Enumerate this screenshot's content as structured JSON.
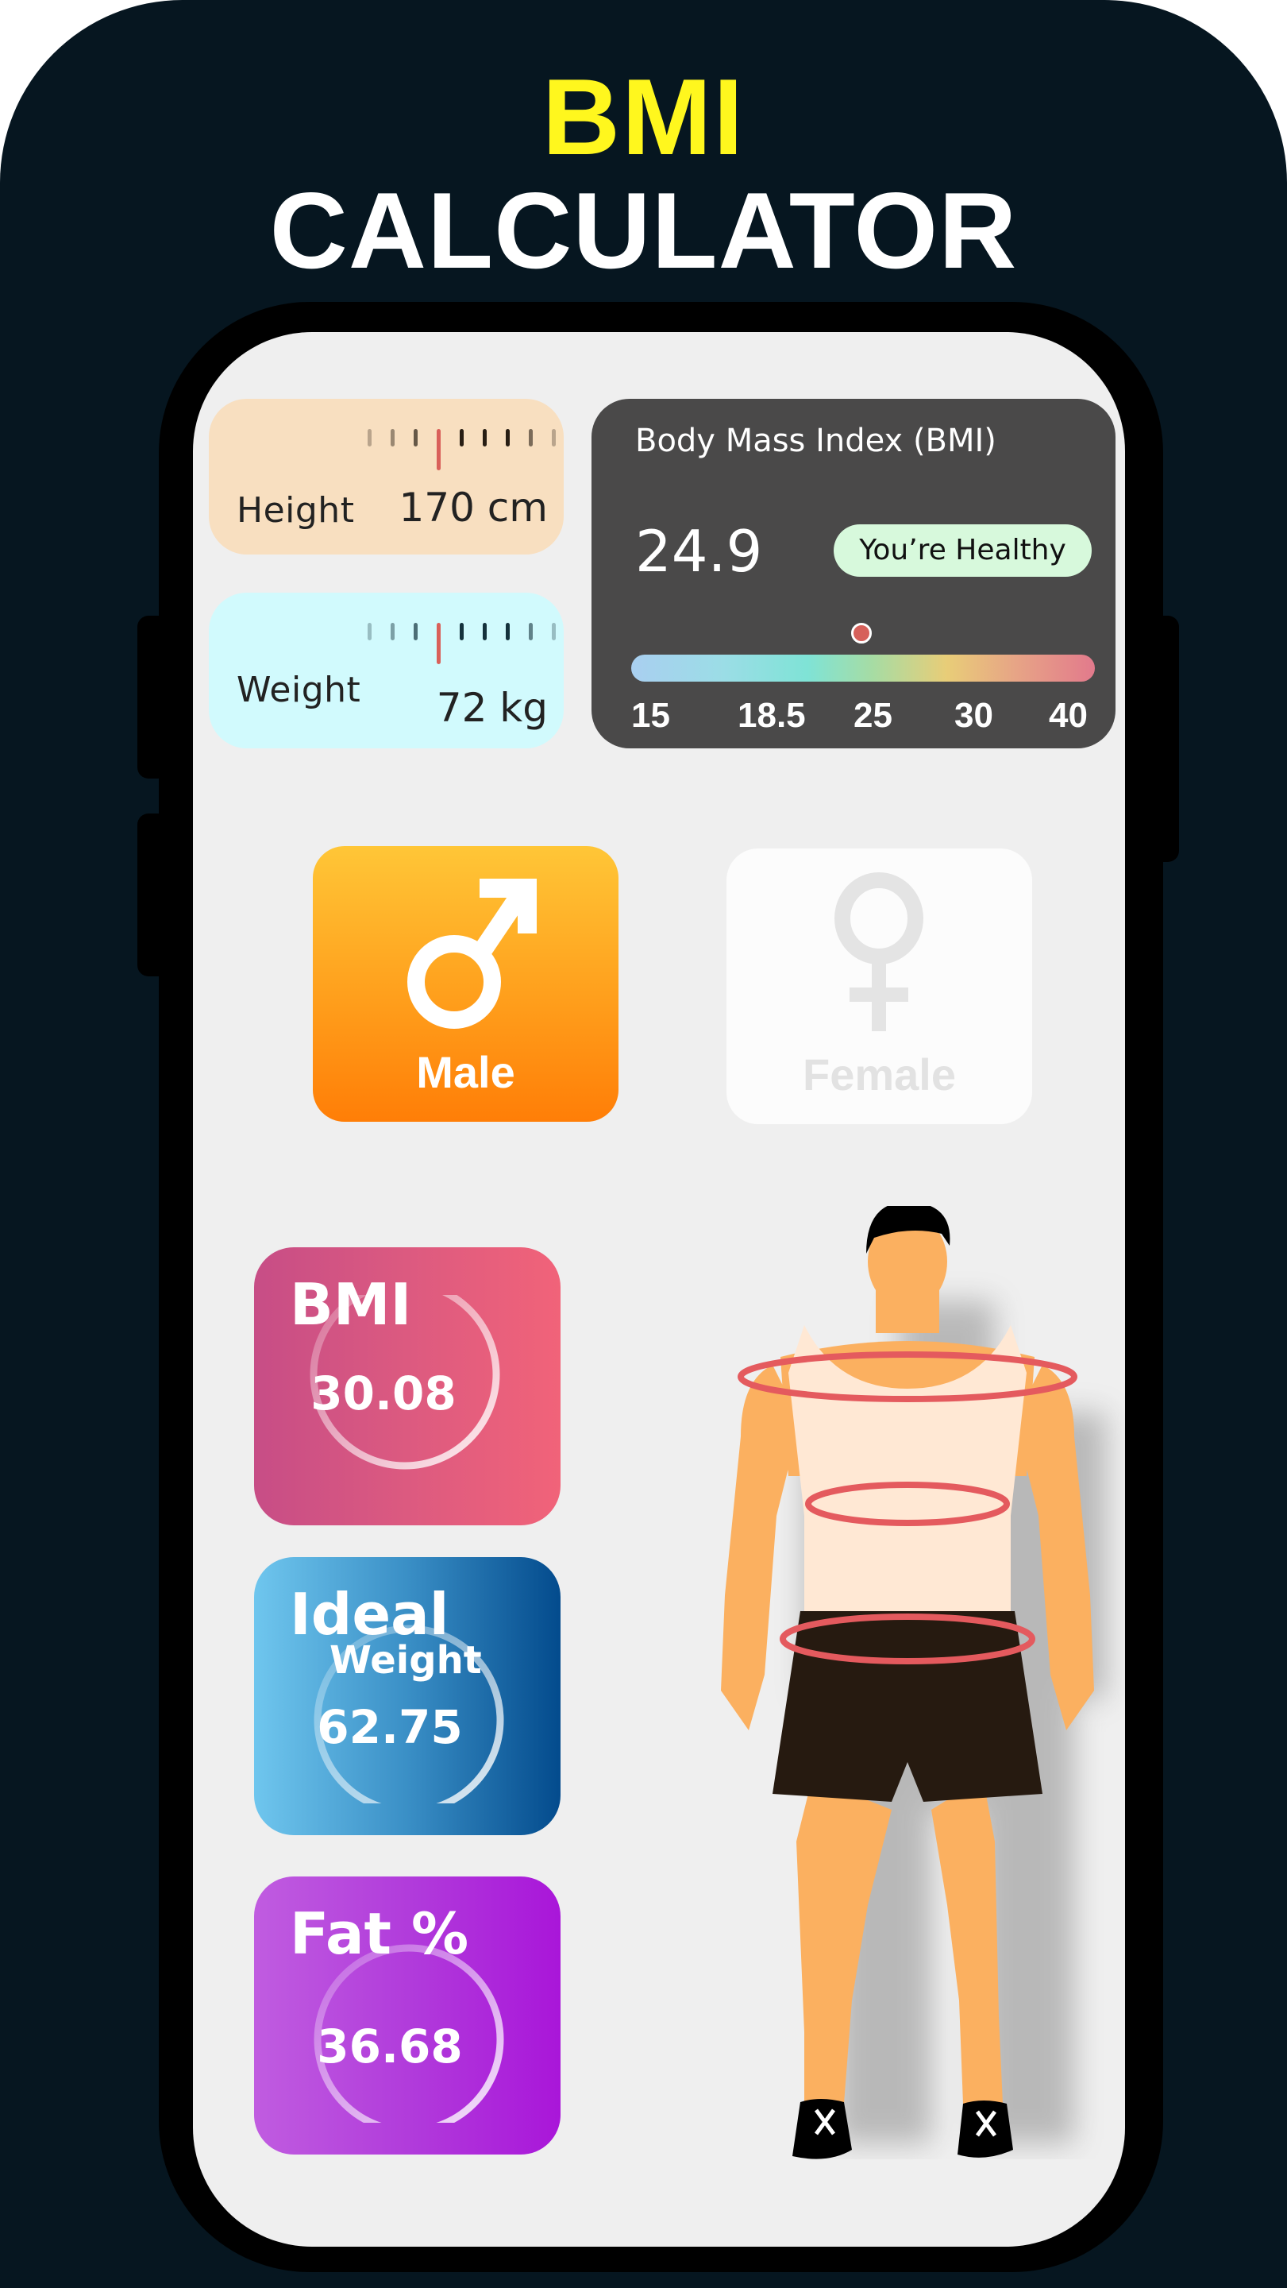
{
  "header": {
    "title_line1": "BMI",
    "title_line2": "CALCULATOR",
    "title_line1_color": "#FFF71E",
    "background_color": "#061620"
  },
  "inputs": {
    "height": {
      "label": "Height",
      "value": "170 cm",
      "card_color": "#F8DFC0"
    },
    "weight": {
      "label": "Weight",
      "value": "72 kg",
      "card_color": "#D1FAFD"
    }
  },
  "bmi_panel": {
    "title": "Body Mass Index (BMI)",
    "value": "24.9",
    "value_numeric": 24.9,
    "status": "You’re Healthy",
    "status_color": "#D7F9DC",
    "scale_labels": [
      "15",
      "18.5",
      "25",
      "30",
      "40"
    ],
    "indicator_color": "#D6605A"
  },
  "gender": {
    "options": [
      {
        "label": "Male",
        "selected": true,
        "icon": "male-symbol-icon"
      },
      {
        "label": "Female",
        "selected": false,
        "icon": "female-symbol-icon"
      }
    ]
  },
  "results": [
    {
      "id": "bmi",
      "title": "BMI",
      "subtitle": "",
      "value": "30.08"
    },
    {
      "id": "ideal",
      "title": "Ideal",
      "subtitle": "Weight",
      "value": "62.75"
    },
    {
      "id": "fat",
      "title": "Fat %",
      "subtitle": "",
      "value": "36.68"
    }
  ],
  "illustration": {
    "description": "male-body-with-measurement-rings",
    "ring_color": "#E45A5E"
  }
}
